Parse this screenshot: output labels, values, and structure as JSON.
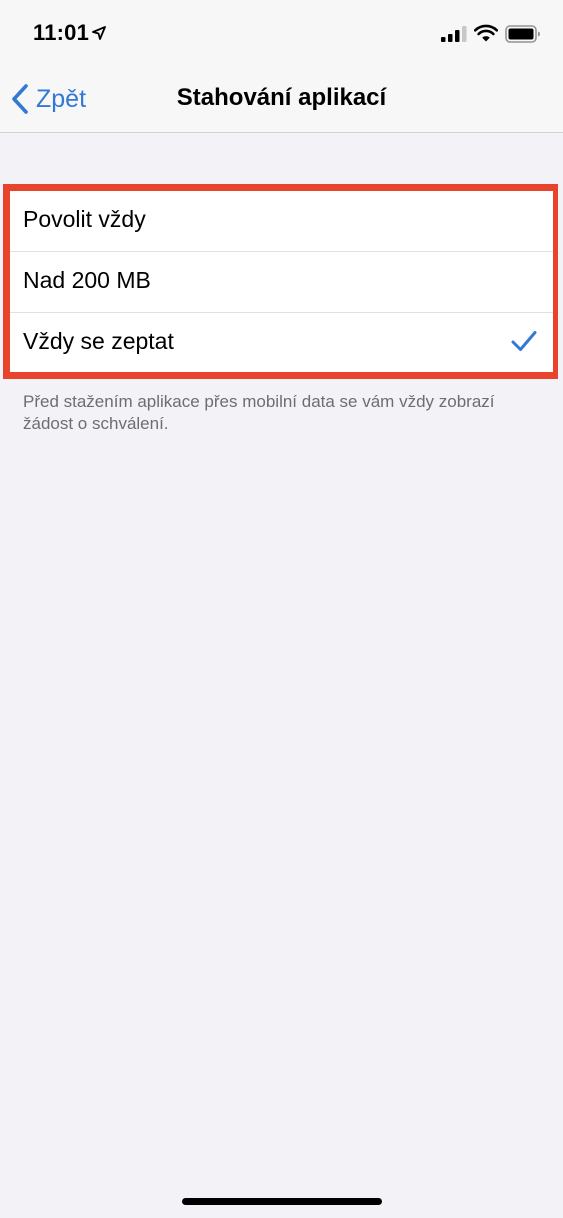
{
  "status_bar": {
    "time": "11:01",
    "icons": [
      "location-arrow-icon",
      "cellular-signal-icon",
      "wifi-icon",
      "battery-icon"
    ]
  },
  "nav": {
    "back_label": "Zpět",
    "title": "Stahování aplikací"
  },
  "options": {
    "items": [
      {
        "label": "Povolit vždy",
        "selected": false
      },
      {
        "label": "Nad 200 MB",
        "selected": false
      },
      {
        "label": "Vždy se zeptat",
        "selected": true
      }
    ],
    "footer": "Před stažením aplikace přes mobilní data se vám vždy zobrazí žádost o schválení."
  },
  "colors": {
    "accent": "#3478d6",
    "highlight_frame": "#e8432d",
    "background": "#f2f2f7"
  }
}
